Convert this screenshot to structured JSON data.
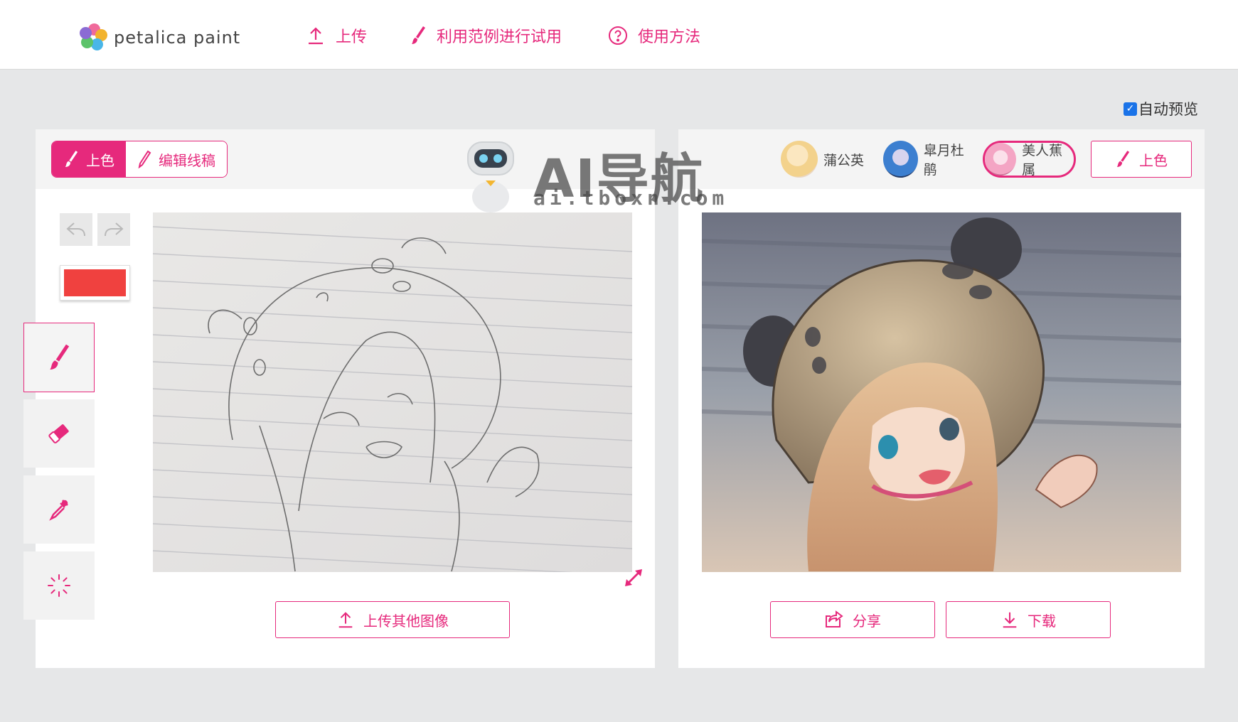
{
  "header": {
    "logo_text": "petalica paint",
    "nav": [
      {
        "label": "上传",
        "icon": "upload-icon"
      },
      {
        "label": "利用范例进行试用",
        "icon": "brush-icon"
      },
      {
        "label": "使用方法",
        "icon": "help-circle-icon"
      }
    ]
  },
  "auto_preview": {
    "label": "自动预览",
    "checked": true
  },
  "left_panel": {
    "tabs": [
      {
        "label": "上色",
        "icon": "brush-icon",
        "active": true
      },
      {
        "label": "编辑线稿",
        "icon": "pencil-icon",
        "active": false
      }
    ],
    "current_color": "#f0413f",
    "tools": [
      "brush-icon",
      "eraser-icon",
      "eyedropper-icon",
      "loading-spinner-icon"
    ],
    "upload_other_label": "上传其他图像"
  },
  "right_panel": {
    "styles": [
      {
        "label": "蒲公英",
        "selected": false
      },
      {
        "label": "皐月杜鹃",
        "selected": false
      },
      {
        "label": "美人蕉属",
        "selected": true
      }
    ],
    "colorize_label": "上色",
    "share_label": "分享",
    "download_label": "下载"
  },
  "watermark": {
    "title": "AI导航",
    "url": "ai.tboxn.com"
  },
  "colors": {
    "accent": "#e6297c",
    "page_bg": "#e6e7e8"
  }
}
